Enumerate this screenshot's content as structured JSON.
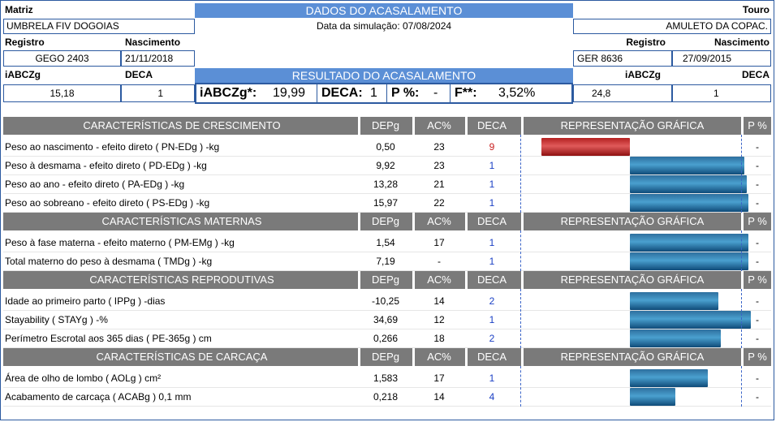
{
  "header": {
    "matriz_label": "Matriz",
    "matriz_name": "UMBRELA FIV DOGOIAS",
    "touro_label": "Touro",
    "touro_name": "AMULETO DA COPAC.",
    "dados_title": "DADOS DO ACASALAMENTO",
    "data_simulacao": "Data da simulação: 07/08/2024",
    "registro_label": "Registro",
    "nascimento_label": "Nascimento",
    "matriz_registro": "GEGO 2403",
    "matriz_nascimento": "21/11/2018",
    "touro_registro": "GER 8636",
    "touro_nascimento": "27/09/2015",
    "iabczg_label": "iABCZg",
    "deca_label": "DECA",
    "matriz_iabczg": "15,18",
    "matriz_deca": "1",
    "touro_iabczg": "24,8",
    "touro_deca": "1",
    "resultado_title": "RESULTADO DO ACASALAMENTO",
    "resultado": {
      "iabczg_label": "iABCZg*:",
      "iabczg_value": "19,99",
      "deca_label": "DECA:",
      "deca_value": "1",
      "p_label": "P %:",
      "p_value": "-",
      "f_label": "F**:",
      "f_value": "3,52%"
    }
  },
  "columns": {
    "depg": "DEPg",
    "ac": "AC%",
    "deca": "DECA",
    "graph": "REPRESENTAÇÃO GRÁFICA",
    "p": "P %"
  },
  "sections": [
    {
      "title": "CARACTERÍSTICAS DE CRESCIMENTO",
      "rows": [
        {
          "name": "Peso ao nascimento - efeito direto ( PN-EDg ) -kg",
          "depg": "0,50",
          "ac": "23",
          "deca": "9",
          "p": "-",
          "bar_dir": "neg",
          "bar_level": 0.41
        },
        {
          "name": "Peso à desmama - efeito direto ( PD-EDg ) -kg",
          "depg": "9,92",
          "ac": "23",
          "deca": "1",
          "p": "-",
          "bar_dir": "pos",
          "bar_level": 0.53
        },
        {
          "name": "Peso ao ano - efeito direto ( PA-EDg ) -kg",
          "depg": "13,28",
          "ac": "21",
          "deca": "1",
          "p": "-",
          "bar_dir": "pos",
          "bar_level": 0.54
        },
        {
          "name": "Peso ao sobreano - efeito direto ( PS-EDg ) -kg",
          "depg": "15,97",
          "ac": "22",
          "deca": "1",
          "p": "-",
          "bar_dir": "pos",
          "bar_level": 0.55
        }
      ]
    },
    {
      "title": "CARACTERÍSTICAS MATERNAS",
      "rows": [
        {
          "name": "Peso à fase materna - efeito materno ( PM-EMg ) -kg",
          "depg": "1,54",
          "ac": "17",
          "deca": "1",
          "p": "-",
          "bar_dir": "pos",
          "bar_level": 0.55
        },
        {
          "name": "Total materno do peso à desmama ( TMDg ) -kg",
          "depg": "7,19",
          "ac": "-",
          "deca": "1",
          "p": "-",
          "bar_dir": "pos",
          "bar_level": 0.55
        }
      ]
    },
    {
      "title": "CARACTERÍSTICAS REPRODUTIVAS",
      "rows": [
        {
          "name": "Idade ao primeiro parto ( IPPg ) -dias",
          "depg": "-10,25",
          "ac": "14",
          "deca": "2",
          "p": "-",
          "bar_dir": "pos",
          "bar_level": 0.41
        },
        {
          "name": "Stayability ( STAYg ) -%",
          "depg": "34,69",
          "ac": "12",
          "deca": "1",
          "p": "-",
          "bar_dir": "pos",
          "bar_level": 0.56
        },
        {
          "name": "Perímetro Escrotal aos 365 dias ( PE-365g ) cm",
          "depg": "0,266",
          "ac": "18",
          "deca": "2",
          "p": "-",
          "bar_dir": "pos",
          "bar_level": 0.42
        }
      ]
    },
    {
      "title": "CARACTERÍSTICAS DE CARCAÇA",
      "rows": [
        {
          "name": "Área de olho de lombo ( AOLg ) cm²",
          "depg": "1,583",
          "ac": "17",
          "deca": "1",
          "p": "-",
          "bar_dir": "pos",
          "bar_level": 0.36
        },
        {
          "name": "Acabamento de carcaça ( ACABg ) 0,1 mm",
          "depg": "0,218",
          "ac": "14",
          "deca": "4",
          "p": "-",
          "bar_dir": "pos",
          "bar_level": 0.21
        }
      ]
    }
  ],
  "colors": {
    "header_blue": "#5b8fd6",
    "section_gray": "#7a7a7a",
    "deca_good": "#1a3fc4",
    "deca_bad": "#c81e1e"
  }
}
